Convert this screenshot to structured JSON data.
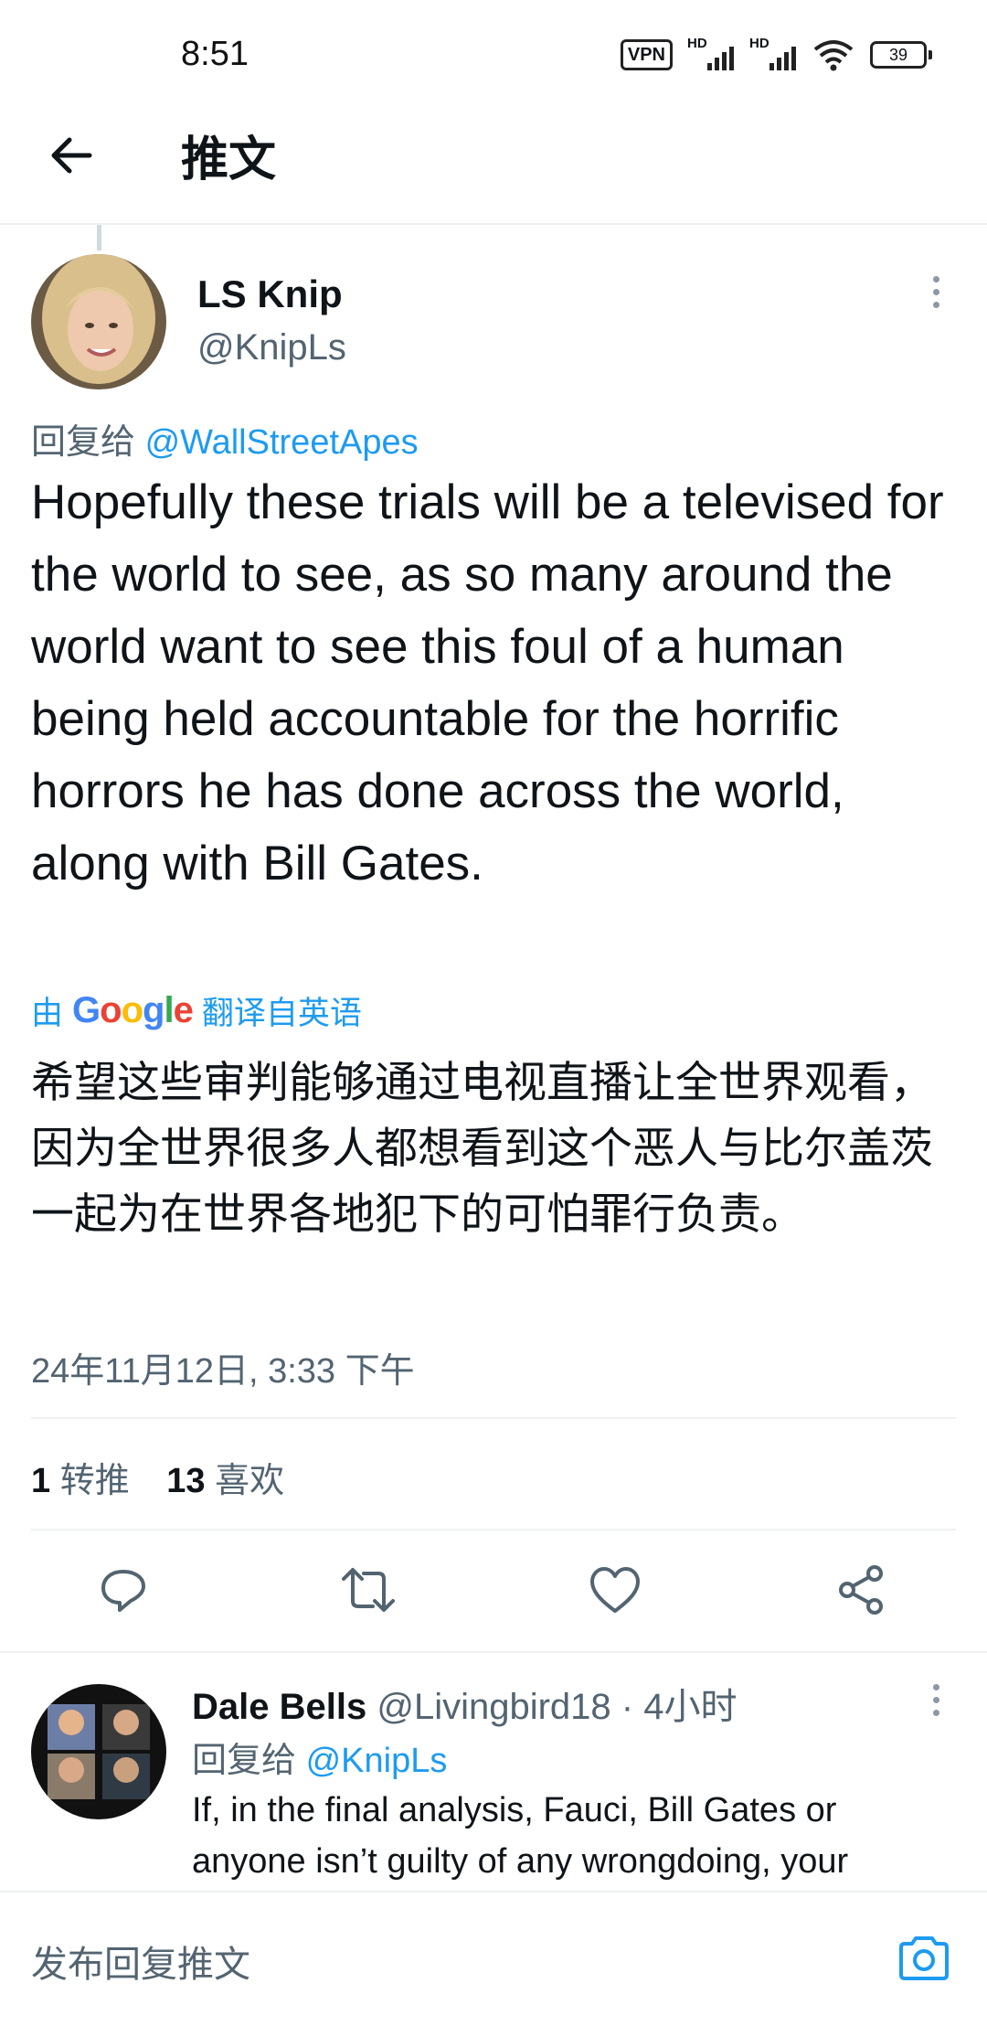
{
  "status_bar": {
    "time": "8:51",
    "vpn": "VPN",
    "hd1": "HD",
    "hd2": "HD",
    "battery": "39"
  },
  "header": {
    "title": "推文",
    "back_icon": "back-arrow-icon"
  },
  "tweet": {
    "author_name": "LS Knip",
    "author_handle": "@KnipLs",
    "reply_prefix": "回复给",
    "reply_target": "@WallStreetApes",
    "text": "Hopefully these trials will be a televised for the world to see, as so many around the world want to see this foul of a human being held accountable for the horrific horrors he has done across the world, along with Bill Gates.",
    "translate_prefix": "由",
    "translate_brand": "Google",
    "translate_suffix": "翻译自英语",
    "translation": "希望这些审判能够通过电视直播让全世界观看，因为全世界很多人都想看到这个恶人与比尔盖茨一起为在世界各地犯下的可怕罪行负责。",
    "timestamp": "24年11月12日, 3:33 下午",
    "retweet_count": "1",
    "retweet_label": "转推",
    "like_count": "13",
    "like_label": "喜欢"
  },
  "actions": [
    "reply-icon",
    "retweet-icon",
    "like-icon",
    "share-icon"
  ],
  "reply": {
    "author_name": "Dale Bells",
    "author_handle": "@Livingbird18",
    "separator": "·",
    "time_ago": "4小时",
    "reply_prefix": "回复给",
    "reply_target": "@KnipLs",
    "text": "If, in the final analysis, Fauci, Bill Gates or anyone isn’t guilty of any wrongdoing, your"
  },
  "compose": {
    "placeholder": "发布回复推文",
    "camera_icon": "camera-icon"
  },
  "colors": {
    "accent": "#1d9bf0",
    "text": "#0f1419",
    "muted": "#536471"
  }
}
